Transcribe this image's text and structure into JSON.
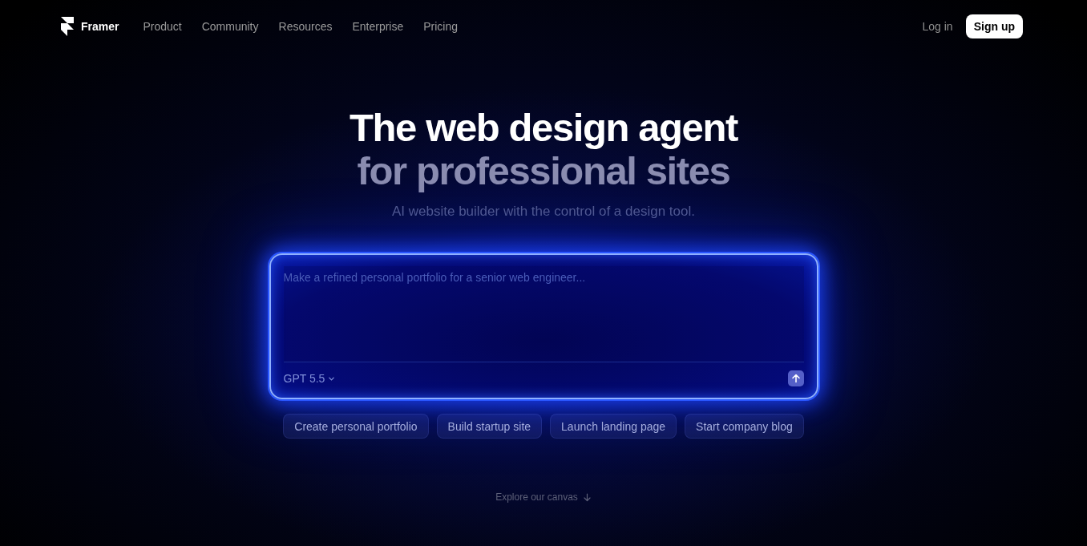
{
  "nav": {
    "logo": "Framer",
    "links": [
      "Product",
      "Community",
      "Resources",
      "Enterprise",
      "Pricing"
    ],
    "login": "Log in",
    "signup": "Sign up"
  },
  "hero": {
    "title": "The web design agent",
    "title_secondary": "for professional sites",
    "subtitle": "AI website builder with the control of a design tool."
  },
  "prompt": {
    "placeholder": "Make a refined personal portfolio for a senior web engineer...",
    "model": "GPT 5.5"
  },
  "suggestions": [
    "Create personal portfolio",
    "Build startup site",
    "Launch landing page",
    "Start company blog"
  ],
  "explore": "Explore our canvas"
}
